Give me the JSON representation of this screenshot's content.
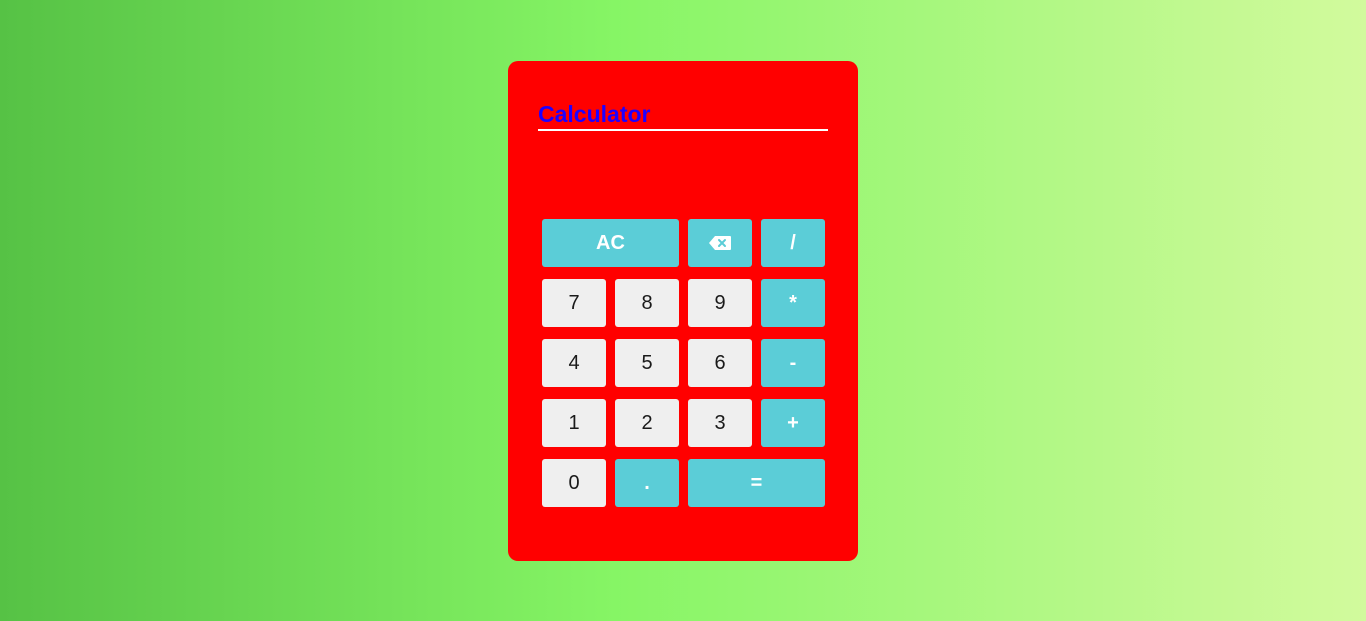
{
  "calculator": {
    "title": "Calculator",
    "display": "",
    "keys": {
      "clear": "AC",
      "backspace_icon": "backspace-icon",
      "divide": "/",
      "seven": "7",
      "eight": "8",
      "nine": "9",
      "multiply": "*",
      "four": "4",
      "five": "5",
      "six": "6",
      "minus": "-",
      "one": "1",
      "two": "2",
      "three": "3",
      "plus": "+",
      "zero": "0",
      "decimal": ".",
      "equals": "="
    }
  },
  "colors": {
    "panel": "#ff0000",
    "title": "#1f00ff",
    "operator_key": "#5bcdd7",
    "number_key": "#efefef",
    "background_start": "#56c245",
    "background_end": "#d2fa9d"
  }
}
